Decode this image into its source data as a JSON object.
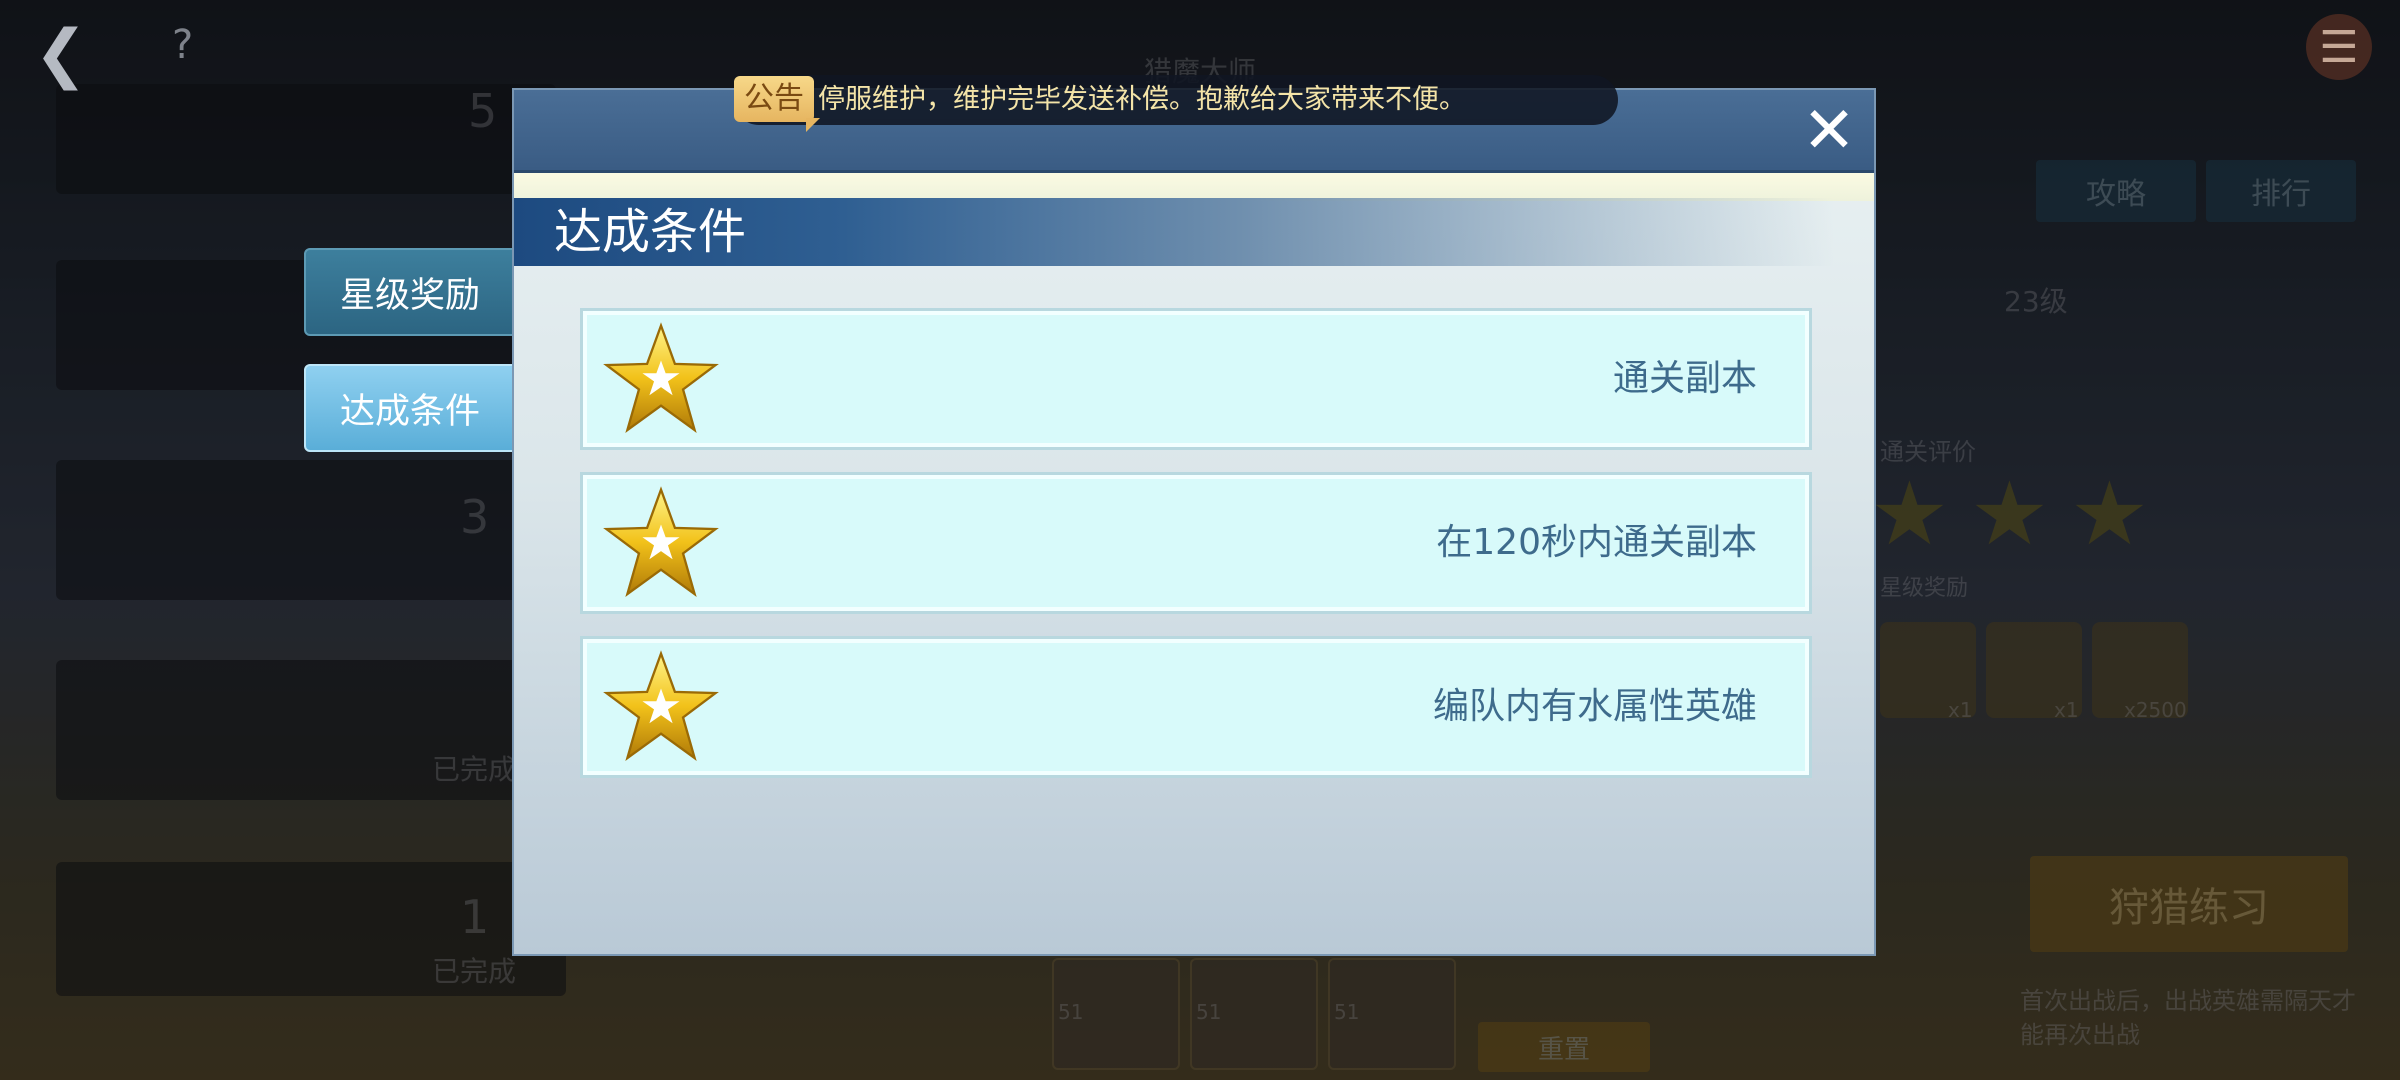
{
  "topbar": {
    "back_icon": "back-arrow-icon",
    "help_icon": "question-icon",
    "menu_icon": "menu-icon",
    "help_label": "?"
  },
  "background": {
    "title": "猎魔大师",
    "strategy_label": "攻略",
    "ranking_label": "排行",
    "level_label": "23级",
    "rating_label": "通关评价",
    "star_reward_label": "星级奖励",
    "hunt_practice_label": "狩猎练习",
    "hint_text": "首次出战后，出战英雄需隔天才能再次出战",
    "reset_label": "重置",
    "completed_label_1": "已完成",
    "completed_label_2": "已完成",
    "item_counts": [
      "x1",
      "x1",
      "x2500"
    ],
    "hero_levels": [
      "51",
      "51",
      "51"
    ],
    "side_numbers": [
      "5",
      "3",
      "1"
    ]
  },
  "side_tabs": [
    {
      "label": "星级奖励",
      "active": false
    },
    {
      "label": "达成条件",
      "active": true
    }
  ],
  "notice": {
    "badge": "公告",
    "text": "停服维护，维护完毕发送补偿。抱歉给大家带来不便。"
  },
  "modal": {
    "close_icon": "close-icon",
    "close_label": "✕",
    "section_title": "达成条件",
    "conditions": [
      {
        "icon": "gold-star-icon",
        "text": "通关副本"
      },
      {
        "icon": "gold-star-icon",
        "text": "在120秒内通关副本"
      },
      {
        "icon": "gold-star-icon",
        "text": "编队内有水属性英雄"
      }
    ]
  },
  "colors": {
    "header_blue": "#3a5c84",
    "title_bar_blue": "#1d4a80",
    "condition_bg": "#d8fafa",
    "condition_text": "#3e6b8c",
    "star_gold": "#f2c21a",
    "active_tab": "#5aaed8"
  }
}
